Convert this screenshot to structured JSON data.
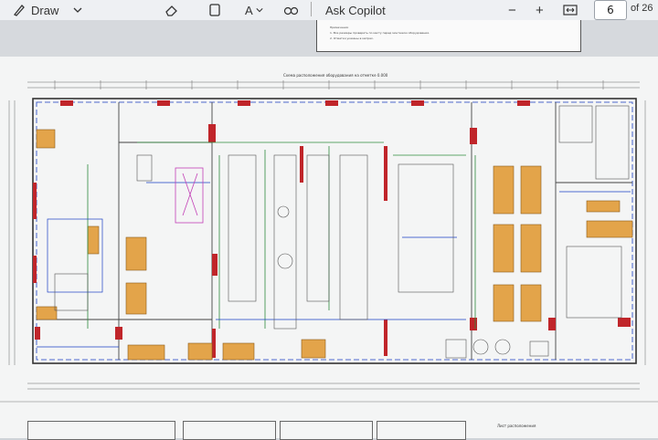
{
  "toolbar": {
    "draw_label": "Draw",
    "text_icon_label": "A",
    "ask_copilot_label": "Ask Copilot",
    "zoom_out_label": "−",
    "zoom_in_label": "+",
    "page_number": "6",
    "page_total": "of 26"
  },
  "document": {
    "top_sheet_notes": [
      "Примечания:",
      "1. Все размеры проверить по месту перед монтажом оборудования.",
      "2. Отметки указаны в метрах."
    ],
    "drawing_title": "Схема расположения оборудования на отметке 0.000",
    "stamp_label": "Лист расположения"
  },
  "colors": {
    "accent_blue": "#1a3fc4",
    "wall_red": "#c0252a",
    "equipment_orange": "#e3a44a",
    "line_green": "#2e8b3d",
    "magenta": "#c23fb6"
  }
}
